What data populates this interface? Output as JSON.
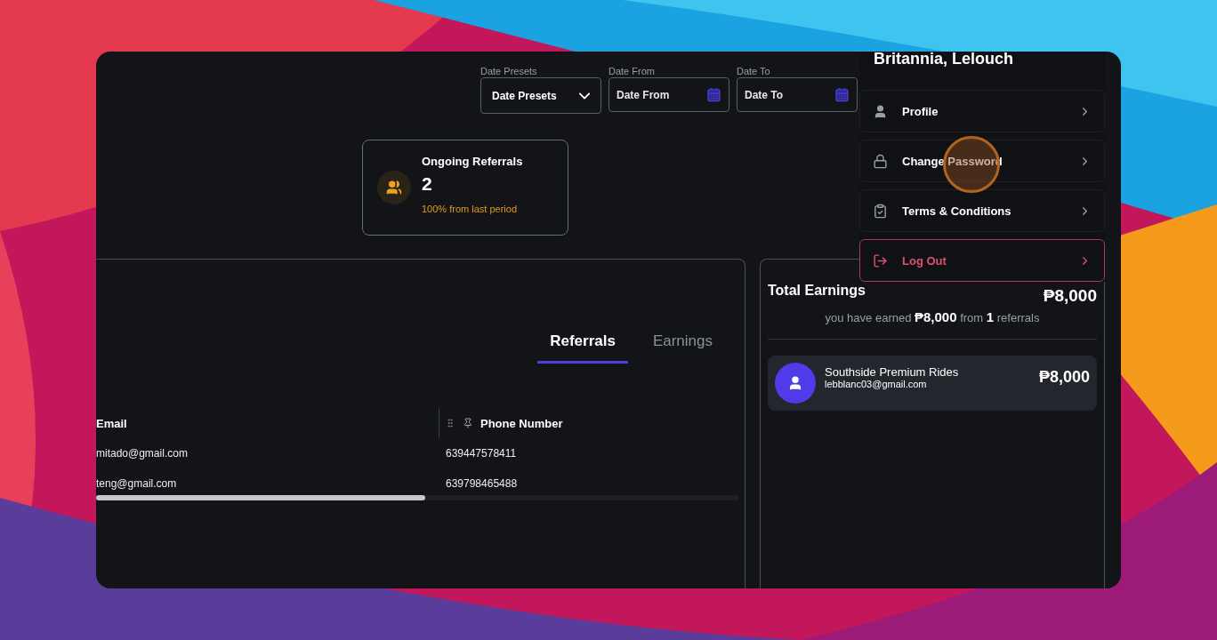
{
  "filters": [
    {
      "label": "Date Presets",
      "placeholder": "Date Presets",
      "kind": "select"
    },
    {
      "label": "Date From",
      "placeholder": "Date From",
      "kind": "date"
    },
    {
      "label": "Date To",
      "placeholder": "Date To",
      "kind": "date"
    }
  ],
  "stat_card": {
    "title": "Ongoing Referrals",
    "value": "2",
    "change": "100% from last period"
  },
  "tabs": [
    {
      "label": "Referrals",
      "selected": true
    },
    {
      "label": "Earnings",
      "selected": false
    }
  ],
  "table": {
    "columns": [
      {
        "label": "Email",
        "pinned": false
      },
      {
        "label": "Phone Number",
        "pinned": true
      }
    ],
    "rows": [
      [
        "mitado@gmail.com",
        "639447578411"
      ],
      [
        "teng@gmail.com",
        "639798465488"
      ]
    ]
  },
  "earnings": {
    "title": "Total Earnings",
    "total": "₱8,000",
    "summary": "you have earned **₱8,000** from **1** referrals",
    "items": [
      {
        "name": "Southside Premium Rides",
        "email": "lebblanc03@gmail.com",
        "amount": "₱8,000"
      }
    ]
  },
  "account_menu": {
    "user_name": "Britannia, Lelouch",
    "items": [
      {
        "label": "Profile",
        "kind": "profile"
      },
      {
        "label": "Change Password",
        "kind": "password"
      },
      {
        "label": "Terms & Conditions",
        "kind": "terms"
      },
      {
        "label": "Log Out",
        "kind": "logout"
      }
    ]
  }
}
